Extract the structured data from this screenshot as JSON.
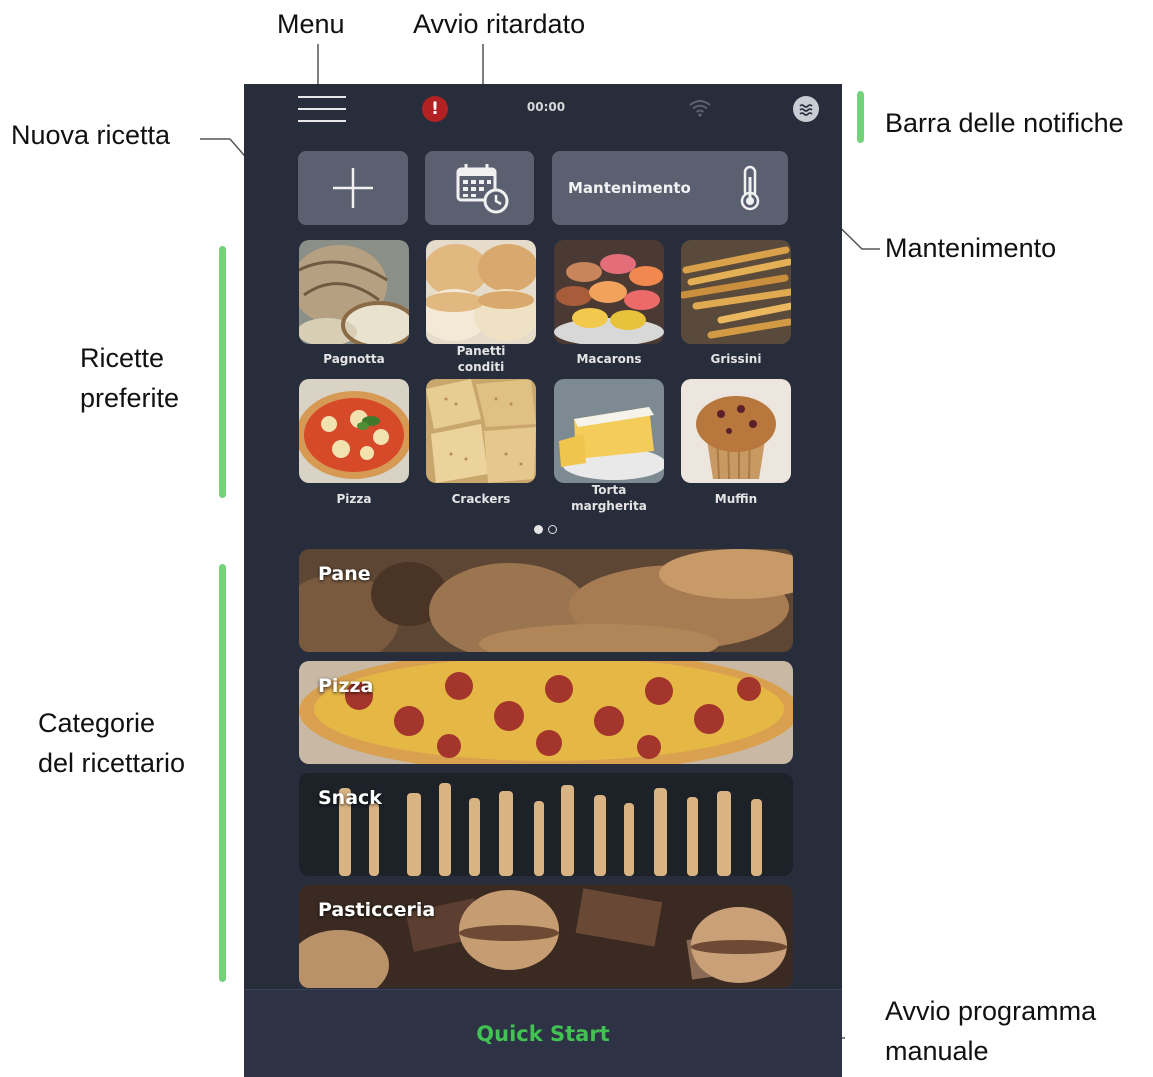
{
  "callouts": {
    "menu": "Menu",
    "delayed_start": "Avvio ritardato",
    "new_recipe": "Nuova ricetta",
    "notification_bar": "Barra delle notifiche",
    "holding": "Mantenimento",
    "favorite_line1": "Ricette",
    "favorite_line2": "preferite",
    "categories_line1": "Categorie",
    "categories_line2": "del ricettario",
    "manual_line1": "Avvio programma",
    "manual_line2": "manuale"
  },
  "statusbar": {
    "time": "00:00",
    "alert_symbol": "!",
    "icons": [
      "menu-icon",
      "alert-icon",
      "wifi-icon",
      "steam-icon"
    ]
  },
  "top_buttons": {
    "new_icon": "plus-icon",
    "delay_icon": "calendar-clock-icon",
    "holding_label": "Mantenimento",
    "holding_icon": "thermometer-icon"
  },
  "favorites": [
    {
      "line1": "Pagnotta",
      "line2": ""
    },
    {
      "line1": "Panetti",
      "line2": "conditi"
    },
    {
      "line1": "Macarons",
      "line2": ""
    },
    {
      "line1": "Grissini",
      "line2": ""
    },
    {
      "line1": "Pizza",
      "line2": ""
    },
    {
      "line1": "Crackers",
      "line2": ""
    },
    {
      "line1": "Torta",
      "line2": "margherita"
    },
    {
      "line1": "Muffin",
      "line2": ""
    }
  ],
  "pager": {
    "pages": 2,
    "current": 1
  },
  "categories": [
    "Pane",
    "Pizza",
    "Snack",
    "Pasticceria"
  ],
  "quick_start": "Quick Start",
  "colors": {
    "background": "#272d3b",
    "button": "#5a6070",
    "accent_green": "#43c254",
    "bracket": "#73d27a",
    "alert": "#b22222"
  }
}
